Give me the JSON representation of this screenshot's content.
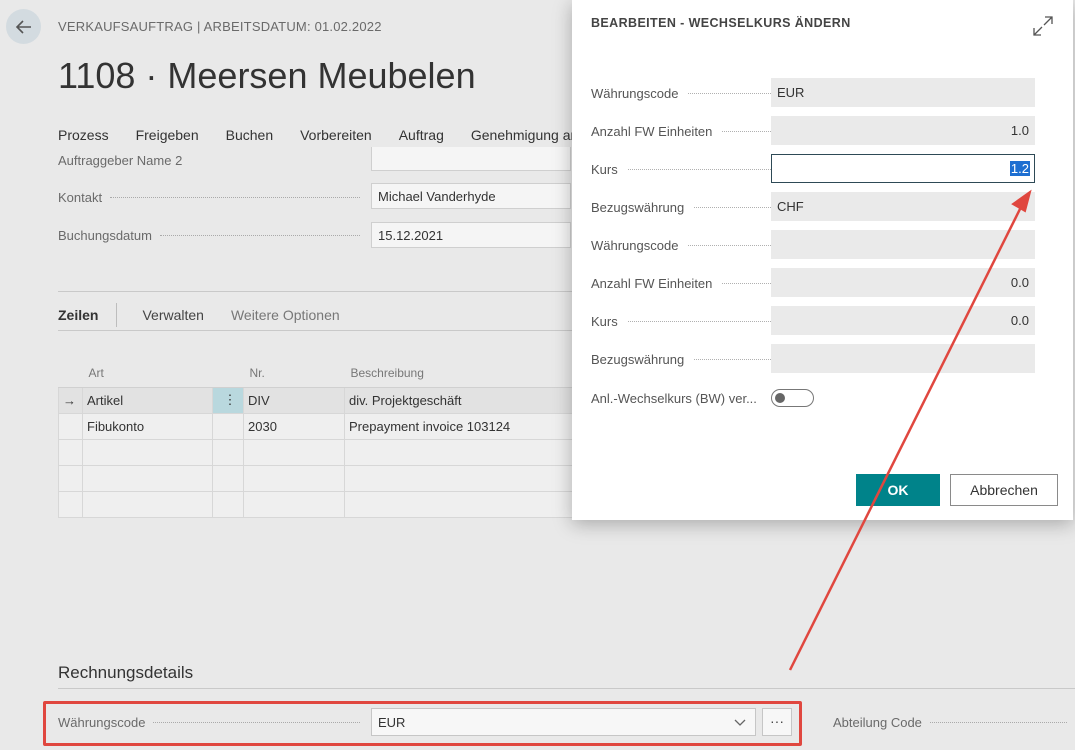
{
  "page": {
    "breadcrumb": "VERKAUFSAUFTRAG | ARBEITSDATUM: 01.02.2022",
    "title": "1108 · Meersen Meubelen",
    "menu": [
      "Prozess",
      "Freigeben",
      "Buchen",
      "Vorbereiten",
      "Auftrag",
      "Genehmigung an"
    ],
    "fields": {
      "auftraggeber_name2_label": "Auftraggeber Name 2",
      "auftraggeber_name2_value": "",
      "kontakt_label": "Kontakt",
      "kontakt_value": "Michael Vanderhyde",
      "buchungsdatum_label": "Buchungsdatum",
      "buchungsdatum_value": "15.12.2021"
    },
    "lines": {
      "tabs": {
        "zeilen": "Zeilen",
        "verwalten": "Verwalten",
        "weitere": "Weitere Optionen"
      },
      "columns": {
        "art": "Art",
        "nr": "Nr.",
        "beschreibung": "Beschreibung"
      },
      "rows": [
        {
          "marker": "→",
          "art": "Artikel",
          "actions": "⋮",
          "nr": "DIV",
          "beschreibung": "div. Projektgeschäft"
        },
        {
          "marker": "",
          "art": "Fibukonto",
          "actions": "",
          "nr": "2030",
          "beschreibung": "Prepayment invoice 103124"
        }
      ]
    },
    "invoice": {
      "section_title": "Rechnungsdetails",
      "waehrungscode_label": "Währungscode",
      "waehrungscode_value": "EUR",
      "ellipsis": "···",
      "abteilung_label": "Abteilung Code"
    }
  },
  "dialog": {
    "title": "BEARBEITEN - WECHSELKURS ÄNDERN",
    "rows": [
      {
        "label": "Währungscode",
        "value": "EUR",
        "numeric": false
      },
      {
        "label": "Anzahl FW Einheiten",
        "value": "1.0",
        "numeric": true
      },
      {
        "label": "Kurs",
        "value": "1.2",
        "numeric": true,
        "active": true
      },
      {
        "label": "Bezugswährung",
        "value": "CHF",
        "numeric": false
      },
      {
        "label": "Währungscode",
        "value": "",
        "numeric": false
      },
      {
        "label": "Anzahl FW Einheiten",
        "value": "0.0",
        "numeric": true
      },
      {
        "label": "Kurs",
        "value": "0.0",
        "numeric": true
      },
      {
        "label": "Bezugswährung",
        "value": "",
        "numeric": false
      }
    ],
    "toggle_label": "Anl.-Wechselkurs (BW) ver...",
    "toggle_on": false,
    "ok_label": "OK",
    "cancel_label": "Abbrechen"
  },
  "colors": {
    "accent": "#00838a",
    "highlight_red": "#e0473f",
    "selection": "#1e6fd1"
  }
}
